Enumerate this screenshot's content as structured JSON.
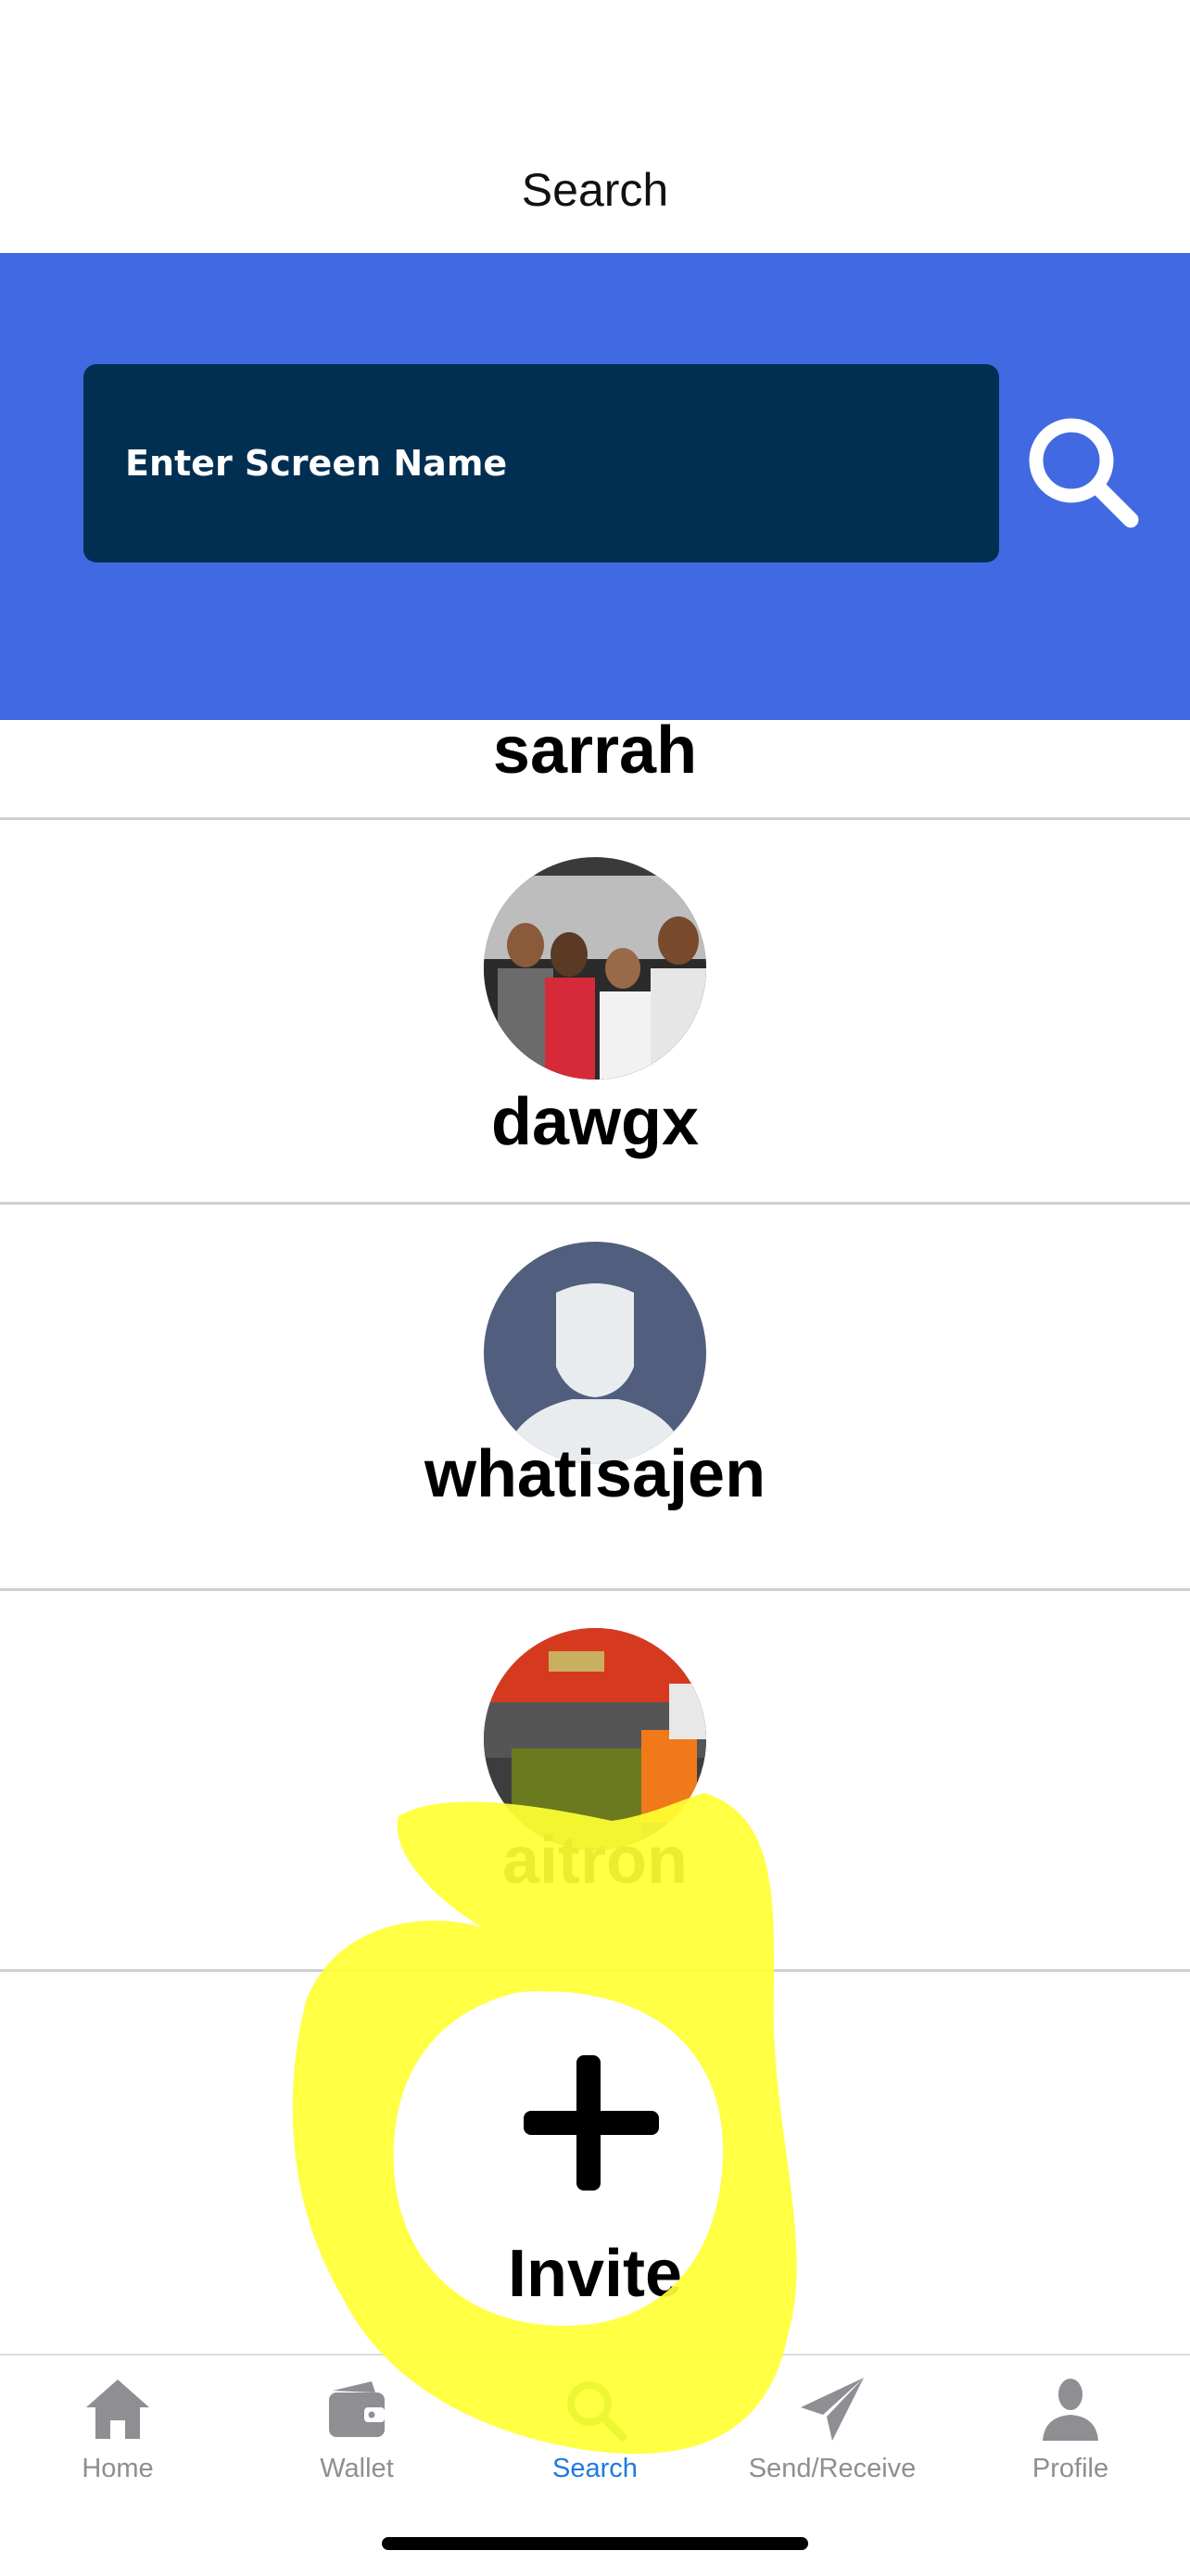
{
  "header": {
    "title": "Search"
  },
  "search": {
    "placeholder": "Enter Screen Name",
    "button_icon": "search-icon"
  },
  "users": [
    {
      "name": "sarrah",
      "avatar": "photo"
    },
    {
      "name": "dawgx",
      "avatar": "group-photo"
    },
    {
      "name": "whatisajen",
      "avatar": "default-silhouette"
    },
    {
      "name": "aitron",
      "avatar": "car-engine-photo"
    }
  ],
  "invite": {
    "label": "Invite",
    "icon": "plus-icon"
  },
  "tabs": [
    {
      "label": "Home",
      "icon": "home-icon"
    },
    {
      "label": "Wallet",
      "icon": "wallet-icon"
    },
    {
      "label": "Search",
      "icon": "search-icon",
      "active": true
    },
    {
      "label": "Send/Receive",
      "icon": "send-icon"
    },
    {
      "label": "Profile",
      "icon": "profile-icon"
    }
  ],
  "colors": {
    "search_band": "#4169e1",
    "search_box": "#002f52",
    "active_tab": "#1f7ae0",
    "inactive_tab": "#8e8e93",
    "highlight": "#ffff33"
  }
}
